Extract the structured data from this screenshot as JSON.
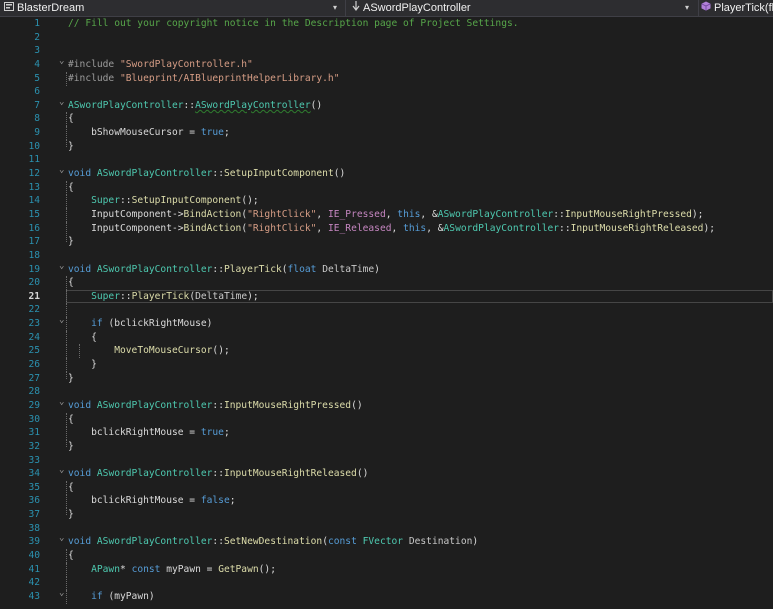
{
  "nav": {
    "project": "BlasterDream",
    "scope": "ASwordPlayController",
    "member": "PlayerTick(flo"
  },
  "colors": {
    "keyword": "#569cd6",
    "comment": "#57a64a",
    "string": "#d69d85",
    "type": "#4ec9b0",
    "function": "#dcdcaa",
    "line_number": "#2b91af",
    "background": "#1e1e1e"
  },
  "editor": {
    "current_line": 21,
    "lines": [
      {
        "n": "1",
        "fold": "",
        "indent": 0,
        "tokens": [
          {
            "c": "c",
            "t": "// Fill out your copyright notice in the Description page of Project Settings."
          }
        ]
      },
      {
        "n": "2",
        "fold": "",
        "indent": 0,
        "tokens": []
      },
      {
        "n": "3",
        "fold": "",
        "indent": 0,
        "tokens": []
      },
      {
        "n": "4",
        "fold": "open",
        "indent": 0,
        "tokens": [
          {
            "c": "d",
            "t": "#include "
          },
          {
            "c": "s",
            "t": "\"SwordPlayController.h\""
          }
        ]
      },
      {
        "n": "5",
        "fold": "bar",
        "indent": 0,
        "tokens": [
          {
            "c": "d",
            "t": "#include "
          },
          {
            "c": "s",
            "t": "\"Blueprint/AIBlueprintHelperLibrary.h\""
          }
        ]
      },
      {
        "n": "6",
        "fold": "",
        "indent": 0,
        "tokens": []
      },
      {
        "n": "7",
        "fold": "open",
        "indent": 0,
        "tokens": [
          {
            "c": "t",
            "t": "ASwordPlayController"
          },
          {
            "c": "",
            "t": "::"
          },
          {
            "c": "t",
            "t": "ASwordPlayController",
            "sq": true
          },
          {
            "c": "",
            "t": "()"
          }
        ]
      },
      {
        "n": "8",
        "fold": "bar",
        "indent": 0,
        "tokens": [
          {
            "c": "",
            "t": "{"
          }
        ]
      },
      {
        "n": "9",
        "fold": "bar",
        "indent": 1,
        "tokens": [
          {
            "c": "",
            "t": "    "
          },
          {
            "c": "m",
            "t": "bShowMouseCursor"
          },
          {
            "c": "",
            "t": " = "
          },
          {
            "c": "k",
            "t": "true"
          },
          {
            "c": "",
            "t": ";"
          }
        ]
      },
      {
        "n": "10",
        "fold": "end",
        "indent": 0,
        "tokens": [
          {
            "c": "",
            "t": "}"
          }
        ]
      },
      {
        "n": "11",
        "fold": "",
        "indent": 0,
        "tokens": []
      },
      {
        "n": "12",
        "fold": "open",
        "indent": 0,
        "tokens": [
          {
            "c": "k",
            "t": "void "
          },
          {
            "c": "t",
            "t": "ASwordPlayController"
          },
          {
            "c": "",
            "t": "::"
          },
          {
            "c": "f",
            "t": "SetupInputComponent"
          },
          {
            "c": "",
            "t": "()"
          }
        ]
      },
      {
        "n": "13",
        "fold": "bar",
        "indent": 0,
        "tokens": [
          {
            "c": "",
            "t": "{"
          }
        ]
      },
      {
        "n": "14",
        "fold": "bar",
        "indent": 1,
        "tokens": [
          {
            "c": "",
            "t": "    "
          },
          {
            "c": "t",
            "t": "Super"
          },
          {
            "c": "",
            "t": "::"
          },
          {
            "c": "f",
            "t": "SetupInputComponent"
          },
          {
            "c": "",
            "t": "();"
          }
        ]
      },
      {
        "n": "15",
        "fold": "bar",
        "indent": 1,
        "tokens": [
          {
            "c": "",
            "t": "    "
          },
          {
            "c": "m",
            "t": "InputComponent"
          },
          {
            "c": "",
            "t": "->"
          },
          {
            "c": "f",
            "t": "BindAction"
          },
          {
            "c": "",
            "t": "("
          },
          {
            "c": "s",
            "t": "\"RightClick\""
          },
          {
            "c": "",
            "t": ", "
          },
          {
            "c": "p",
            "t": "IE_Pressed"
          },
          {
            "c": "",
            "t": ", "
          },
          {
            "c": "k",
            "t": "this"
          },
          {
            "c": "",
            "t": ", &"
          },
          {
            "c": "t",
            "t": "ASwordPlayController"
          },
          {
            "c": "",
            "t": "::"
          },
          {
            "c": "f",
            "t": "InputMouseRightPressed"
          },
          {
            "c": "",
            "t": ");"
          }
        ]
      },
      {
        "n": "16",
        "fold": "bar",
        "indent": 1,
        "tokens": [
          {
            "c": "",
            "t": "    "
          },
          {
            "c": "m",
            "t": "InputComponent"
          },
          {
            "c": "",
            "t": "->"
          },
          {
            "c": "f",
            "t": "BindAction"
          },
          {
            "c": "",
            "t": "("
          },
          {
            "c": "s",
            "t": "\"RightClick\""
          },
          {
            "c": "",
            "t": ", "
          },
          {
            "c": "p",
            "t": "IE_Released"
          },
          {
            "c": "",
            "t": ", "
          },
          {
            "c": "k",
            "t": "this"
          },
          {
            "c": "",
            "t": ", &"
          },
          {
            "c": "t",
            "t": "ASwordPlayController"
          },
          {
            "c": "",
            "t": "::"
          },
          {
            "c": "f",
            "t": "InputMouseRightReleased"
          },
          {
            "c": "",
            "t": ");"
          }
        ]
      },
      {
        "n": "17",
        "fold": "end",
        "indent": 0,
        "tokens": [
          {
            "c": "",
            "t": "}"
          }
        ]
      },
      {
        "n": "18",
        "fold": "",
        "indent": 0,
        "tokens": []
      },
      {
        "n": "19",
        "fold": "open",
        "indent": 0,
        "tokens": [
          {
            "c": "k",
            "t": "void "
          },
          {
            "c": "t",
            "t": "ASwordPlayController"
          },
          {
            "c": "",
            "t": "::"
          },
          {
            "c": "f",
            "t": "PlayerTick"
          },
          {
            "c": "",
            "t": "("
          },
          {
            "c": "k",
            "t": "float "
          },
          {
            "c": "fn",
            "t": "DeltaTime"
          },
          {
            "c": "",
            "t": ")"
          }
        ]
      },
      {
        "n": "20",
        "fold": "bar",
        "indent": 0,
        "tokens": [
          {
            "c": "",
            "t": "{"
          }
        ]
      },
      {
        "n": "21",
        "fold": "bar",
        "indent": 1,
        "tokens": [
          {
            "c": "",
            "t": "    "
          },
          {
            "c": "t",
            "t": "Super"
          },
          {
            "c": "",
            "t": "::"
          },
          {
            "c": "f",
            "t": "PlayerTick"
          },
          {
            "c": "",
            "t": "("
          },
          {
            "c": "fn",
            "t": "DeltaTime"
          },
          {
            "c": "",
            "t": ");"
          }
        ]
      },
      {
        "n": "22",
        "fold": "bar",
        "indent": 1,
        "tokens": []
      },
      {
        "n": "23",
        "fold": "open",
        "indent": 1,
        "tokens": [
          {
            "c": "",
            "t": "    "
          },
          {
            "c": "k",
            "t": "if"
          },
          {
            "c": "",
            "t": " ("
          },
          {
            "c": "m",
            "t": "bclickRightMouse"
          },
          {
            "c": "",
            "t": ")"
          }
        ]
      },
      {
        "n": "24",
        "fold": "bar",
        "indent": 1,
        "tokens": [
          {
            "c": "",
            "t": "    {"
          }
        ]
      },
      {
        "n": "25",
        "fold": "bar",
        "indent": 2,
        "tokens": [
          {
            "c": "",
            "t": "        "
          },
          {
            "c": "f",
            "t": "MoveToMouseCursor"
          },
          {
            "c": "",
            "t": "();"
          }
        ]
      },
      {
        "n": "26",
        "fold": "bar",
        "indent": 1,
        "tokens": [
          {
            "c": "",
            "t": "    }"
          }
        ]
      },
      {
        "n": "27",
        "fold": "end",
        "indent": 0,
        "tokens": [
          {
            "c": "",
            "t": "}"
          }
        ]
      },
      {
        "n": "28",
        "fold": "",
        "indent": 0,
        "tokens": []
      },
      {
        "n": "29",
        "fold": "open",
        "indent": 0,
        "tokens": [
          {
            "c": "k",
            "t": "void "
          },
          {
            "c": "t",
            "t": "ASwordPlayController"
          },
          {
            "c": "",
            "t": "::"
          },
          {
            "c": "f",
            "t": "InputMouseRightPressed"
          },
          {
            "c": "",
            "t": "()"
          }
        ]
      },
      {
        "n": "30",
        "fold": "bar",
        "indent": 0,
        "tokens": [
          {
            "c": "",
            "t": "{"
          }
        ]
      },
      {
        "n": "31",
        "fold": "bar",
        "indent": 1,
        "tokens": [
          {
            "c": "",
            "t": "    "
          },
          {
            "c": "m",
            "t": "bclickRightMouse"
          },
          {
            "c": "",
            "t": " = "
          },
          {
            "c": "k",
            "t": "true"
          },
          {
            "c": "",
            "t": ";"
          }
        ]
      },
      {
        "n": "32",
        "fold": "end",
        "indent": 0,
        "tokens": [
          {
            "c": "",
            "t": "}"
          }
        ]
      },
      {
        "n": "33",
        "fold": "",
        "indent": 0,
        "tokens": []
      },
      {
        "n": "34",
        "fold": "open",
        "indent": 0,
        "tokens": [
          {
            "c": "k",
            "t": "void "
          },
          {
            "c": "t",
            "t": "ASwordPlayController"
          },
          {
            "c": "",
            "t": "::"
          },
          {
            "c": "f",
            "t": "InputMouseRightReleased"
          },
          {
            "c": "",
            "t": "()"
          }
        ]
      },
      {
        "n": "35",
        "fold": "bar",
        "indent": 0,
        "tokens": [
          {
            "c": "",
            "t": "{"
          }
        ]
      },
      {
        "n": "36",
        "fold": "bar",
        "indent": 1,
        "tokens": [
          {
            "c": "",
            "t": "    "
          },
          {
            "c": "m",
            "t": "bclickRightMouse"
          },
          {
            "c": "",
            "t": " = "
          },
          {
            "c": "k",
            "t": "false"
          },
          {
            "c": "",
            "t": ";"
          }
        ]
      },
      {
        "n": "37",
        "fold": "end",
        "indent": 0,
        "tokens": [
          {
            "c": "",
            "t": "}"
          }
        ]
      },
      {
        "n": "38",
        "fold": "",
        "indent": 0,
        "tokens": []
      },
      {
        "n": "39",
        "fold": "open",
        "indent": 0,
        "tokens": [
          {
            "c": "k",
            "t": "void "
          },
          {
            "c": "t",
            "t": "ASwordPlayController"
          },
          {
            "c": "",
            "t": "::"
          },
          {
            "c": "f",
            "t": "SetNewDestination"
          },
          {
            "c": "",
            "t": "("
          },
          {
            "c": "k",
            "t": "const "
          },
          {
            "c": "t",
            "t": "FVector"
          },
          {
            "c": "",
            "t": " "
          },
          {
            "c": "fn",
            "t": "Destination"
          },
          {
            "c": "",
            "t": ")"
          }
        ]
      },
      {
        "n": "40",
        "fold": "bar",
        "indent": 0,
        "tokens": [
          {
            "c": "",
            "t": "{"
          }
        ]
      },
      {
        "n": "41",
        "fold": "bar",
        "indent": 1,
        "tokens": [
          {
            "c": "",
            "t": "    "
          },
          {
            "c": "t",
            "t": "APawn"
          },
          {
            "c": "",
            "t": "* "
          },
          {
            "c": "k",
            "t": "const "
          },
          {
            "c": "m",
            "t": "myPawn"
          },
          {
            "c": "",
            "t": " = "
          },
          {
            "c": "f",
            "t": "GetPawn"
          },
          {
            "c": "",
            "t": "();"
          }
        ]
      },
      {
        "n": "42",
        "fold": "bar",
        "indent": 1,
        "tokens": []
      },
      {
        "n": "43",
        "fold": "open",
        "indent": 1,
        "tokens": [
          {
            "c": "",
            "t": "    "
          },
          {
            "c": "k",
            "t": "if"
          },
          {
            "c": "",
            "t": " ("
          },
          {
            "c": "m",
            "t": "myPawn"
          },
          {
            "c": "",
            "t": ")"
          }
        ]
      }
    ]
  }
}
